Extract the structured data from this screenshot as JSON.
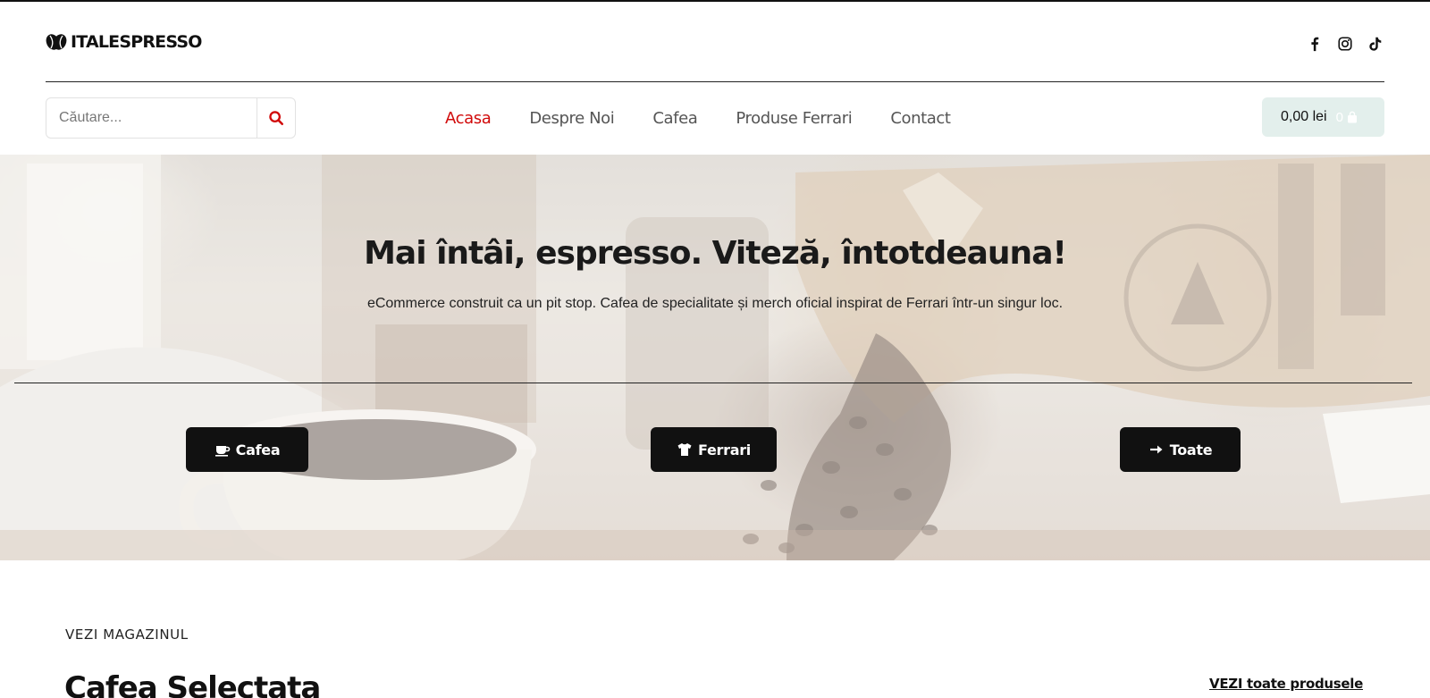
{
  "brand": {
    "name": "ITALESPRESSO"
  },
  "socials": [
    {
      "icon": "facebook-icon"
    },
    {
      "icon": "instagram-icon"
    },
    {
      "icon": "tiktok-icon"
    }
  ],
  "search": {
    "placeholder": "Căutare...",
    "value": "",
    "icon": "search-icon"
  },
  "nav": {
    "items": [
      {
        "label": "Acasa",
        "active": true
      },
      {
        "label": "Despre Noi",
        "active": false
      },
      {
        "label": "Cafea",
        "active": false
      },
      {
        "label": "Produse Ferrari",
        "active": false
      },
      {
        "label": "Contact",
        "active": false
      }
    ]
  },
  "cart": {
    "total": "0,00 lei",
    "count": "0",
    "icon": "shopping-bag-icon"
  },
  "hero": {
    "title": "Mai întâi, espresso. Viteză, întotdeauna!",
    "subtitle": "eCommerce construit ca un pit stop. Cafea de specialitate și merch oficial inspirat de Ferrari într-un singur loc.",
    "buttons": [
      {
        "label": "Cafea",
        "icon": "coffee-cup-icon"
      },
      {
        "label": "Ferrari",
        "icon": "tshirt-icon"
      },
      {
        "label": "Toate",
        "icon": "arrow-right-icon"
      }
    ]
  },
  "shop": {
    "eyebrow": "VEZI MAGAZINUL",
    "title": "Cafea Selectata",
    "see_all": "VEZI toate produsele"
  },
  "colors": {
    "accent": "#d10a0a",
    "cart_bg": "#e3efec",
    "button_bg": "#111111"
  }
}
